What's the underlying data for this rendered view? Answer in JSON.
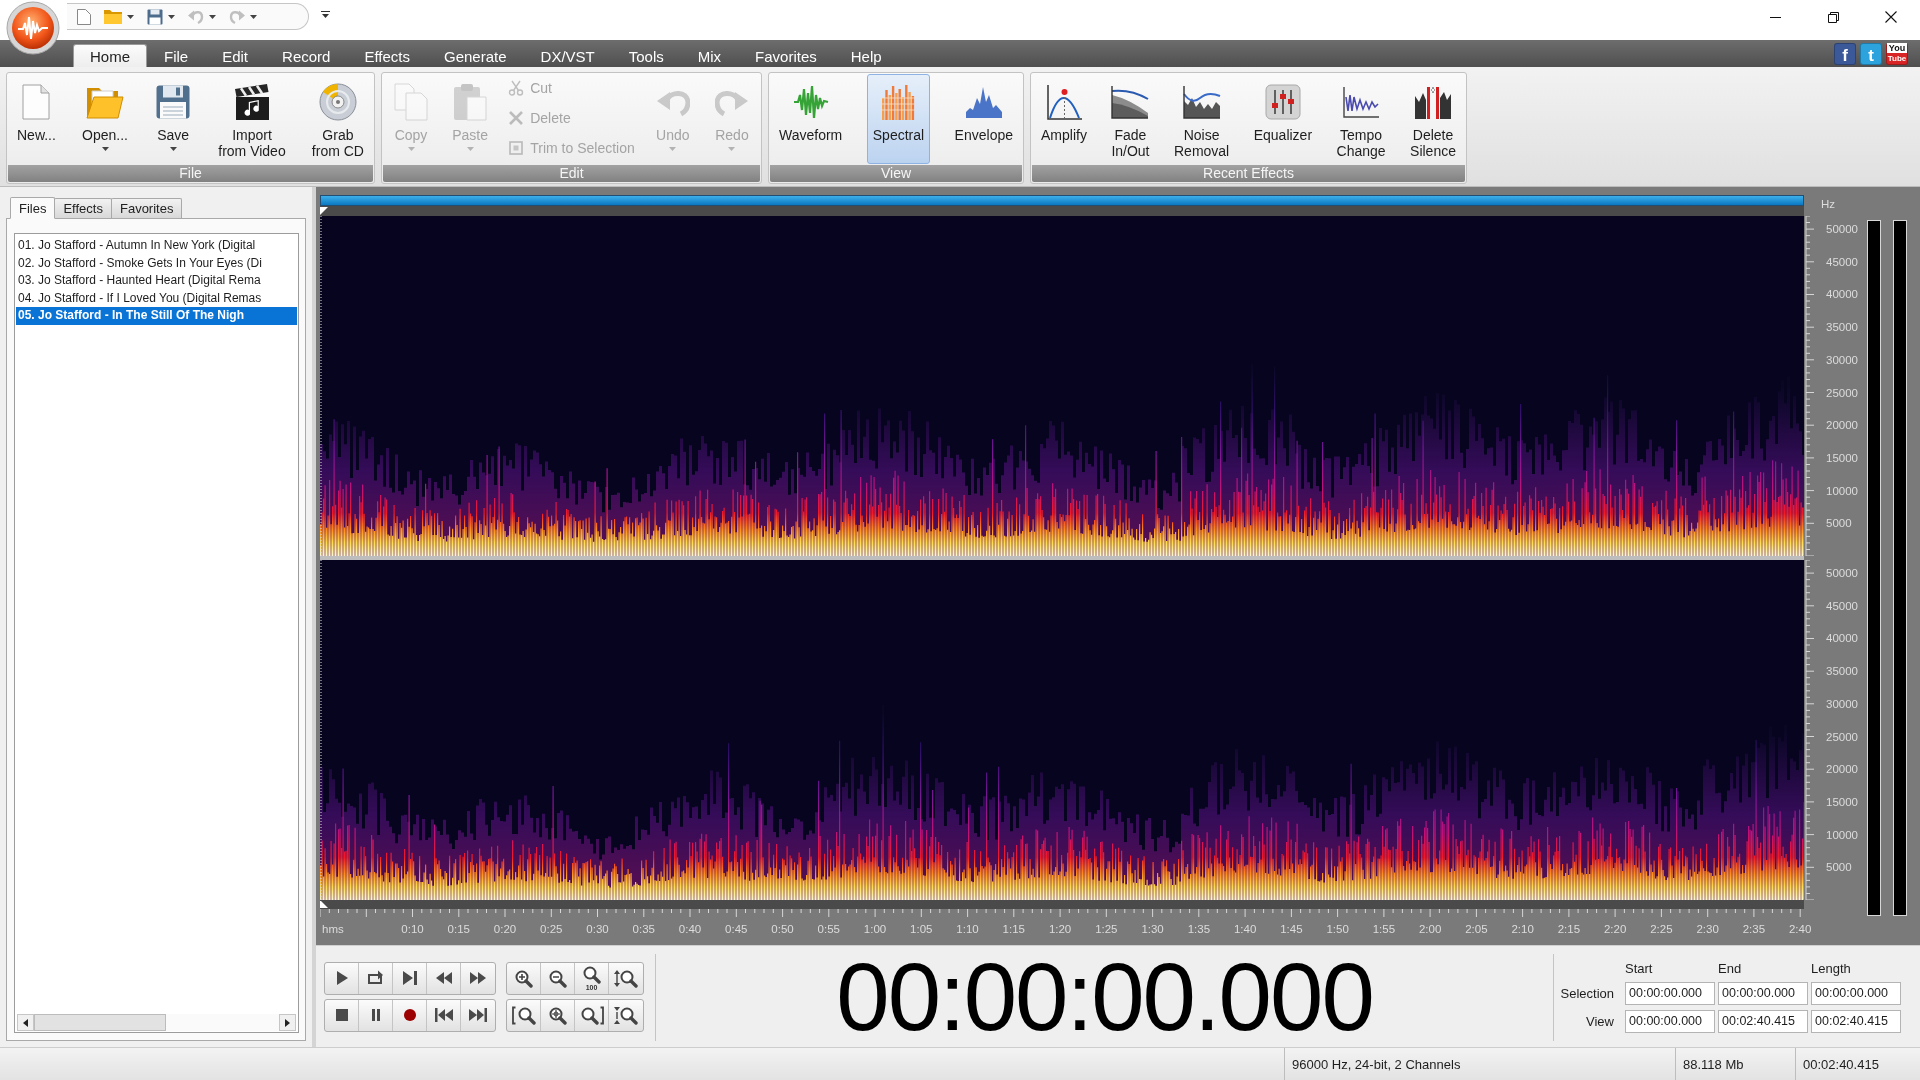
{
  "quick_access_toolbar": [
    {
      "disabled": false,
      "has_dropdown": false
    },
    {
      "disabled": false,
      "has_dropdown": true
    },
    {
      "disabled": false,
      "has_dropdown": true
    },
    {
      "disabled": true,
      "has_dropdown": true
    },
    {
      "disabled": true,
      "has_dropdown": true
    }
  ],
  "menu_tabs": [
    {
      "label": "Home",
      "selected": true
    },
    {
      "label": "File",
      "selected": false
    },
    {
      "label": "Edit",
      "selected": false
    },
    {
      "label": "Record",
      "selected": false
    },
    {
      "label": "Effects",
      "selected": false
    },
    {
      "label": "Generate",
      "selected": false
    },
    {
      "label": "DX/VST",
      "selected": false
    },
    {
      "label": "Tools",
      "selected": false
    },
    {
      "label": "Mix",
      "selected": false
    },
    {
      "label": "Favorites",
      "selected": false
    },
    {
      "label": "Help",
      "selected": false
    }
  ],
  "social_buttons": [
    {
      "kind": "letter",
      "text": "f",
      "color": "#3b5998"
    },
    {
      "kind": "letter",
      "text": "t",
      "color": "#2da3dd"
    },
    {
      "kind": "stacked",
      "text": "You",
      "text_2": "Tube",
      "color": "#d82424"
    }
  ],
  "ribbon": {
    "groups": [
      {
        "label": "File",
        "items": [
          {
            "kind": "large",
            "label": "New...",
            "disabled": false,
            "has_dropdown": false
          },
          {
            "kind": "large",
            "label": "Open...",
            "disabled": false,
            "has_dropdown": true
          },
          {
            "kind": "large",
            "label": "Save",
            "disabled": false,
            "has_dropdown": true
          },
          {
            "kind": "large",
            "label": "Import\nfrom Video",
            "disabled": false,
            "has_dropdown": false
          },
          {
            "kind": "large",
            "label": "Grab\nfrom CD",
            "disabled": false,
            "has_dropdown": false
          }
        ]
      },
      {
        "label": "Edit",
        "items": [
          {
            "kind": "large",
            "label": "Copy",
            "disabled": true,
            "has_dropdown": true
          },
          {
            "kind": "large",
            "label": "Paste",
            "disabled": true,
            "has_dropdown": true
          },
          {
            "kind": "small",
            "label": "Cut",
            "disabled": true,
            "has_dropdown": false
          },
          {
            "kind": "small",
            "label": "Delete",
            "disabled": true,
            "has_dropdown": false
          },
          {
            "kind": "small",
            "label": "Trim to Selection",
            "disabled": true,
            "has_dropdown": false
          },
          {
            "kind": "large",
            "label": "Undo",
            "disabled": true,
            "has_dropdown": true
          },
          {
            "kind": "large",
            "label": "Redo",
            "disabled": true,
            "has_dropdown": true
          }
        ]
      },
      {
        "label": "View",
        "items": [
          {
            "kind": "large",
            "label": "Waveform",
            "disabled": false,
            "has_dropdown": false,
            "selected": false
          },
          {
            "kind": "large",
            "label": "Spectral",
            "disabled": false,
            "has_dropdown": false,
            "selected": true
          },
          {
            "kind": "large",
            "label": "Envelope",
            "disabled": false,
            "has_dropdown": false,
            "selected": false
          }
        ]
      },
      {
        "label": "Recent Effects",
        "items": [
          {
            "kind": "large",
            "label": "Amplify",
            "disabled": false,
            "has_dropdown": false
          },
          {
            "kind": "large",
            "label": "Fade\nIn/Out",
            "disabled": false,
            "has_dropdown": false
          },
          {
            "kind": "large",
            "label": "Noise\nRemoval",
            "disabled": false,
            "has_dropdown": false
          },
          {
            "kind": "large",
            "label": "Equalizer",
            "disabled": false,
            "has_dropdown": false
          },
          {
            "kind": "large",
            "label": "Tempo\nChange",
            "disabled": false,
            "has_dropdown": false
          },
          {
            "kind": "large",
            "label": "Delete\nSilence",
            "disabled": false,
            "has_dropdown": false
          }
        ]
      }
    ]
  },
  "sidebar": {
    "tabs": [
      {
        "label": "Files",
        "selected": true
      },
      {
        "label": "Effects",
        "selected": false
      },
      {
        "label": "Favorites",
        "selected": false
      }
    ],
    "files": [
      {
        "name": "01. Jo Stafford - Autumn In New York (Digital",
        "selected": false
      },
      {
        "name": "02. Jo Stafford - Smoke Gets In Your Eyes (Di",
        "selected": false
      },
      {
        "name": "03. Jo Stafford - Haunted Heart (Digital Rema",
        "selected": false
      },
      {
        "name": "04. Jo Stafford - If I Loved You (Digital Remas",
        "selected": false
      },
      {
        "name": "05. Jo Stafford - In The Still Of The Nigh",
        "selected": true
      }
    ]
  },
  "editor": {
    "frequency_axis": {
      "unit": "Hz",
      "channels": [
        {
          "labels": [
            "50000",
            "45000",
            "40000",
            "35000",
            "30000",
            "25000",
            "20000",
            "15000",
            "10000",
            "5000"
          ]
        },
        {
          "labels": [
            "50000",
            "45000",
            "40000",
            "35000",
            "30000",
            "25000",
            "20000",
            "15000",
            "10000",
            "5000"
          ]
        }
      ]
    },
    "time_axis": {
      "unit": "hms",
      "labels": [
        "0:10",
        "0:15",
        "0:20",
        "0:25",
        "0:30",
        "0:35",
        "0:40",
        "0:45",
        "0:50",
        "0:55",
        "1:00",
        "1:05",
        "1:10",
        "1:15",
        "1:20",
        "1:25",
        "1:30",
        "1:35",
        "1:40",
        "1:45",
        "1:50",
        "1:55",
        "2:00",
        "2:05",
        "2:10",
        "2:15",
        "2:20",
        "2:25",
        "2:30",
        "2:35",
        "2:40"
      ]
    }
  },
  "zoom_toolbar": {
    "badge": "100"
  },
  "time_display": "00:00:00.000",
  "selection_panel": {
    "columns": [
      "Start",
      "End",
      "Length"
    ],
    "rows": [
      {
        "label": "Selection",
        "values": [
          "00:00:00.000",
          "00:00:00.000",
          "00:00:00.000"
        ]
      },
      {
        "label": "View",
        "values": [
          "00:00:00.000",
          "00:02:40.415",
          "00:02:40.415"
        ]
      }
    ]
  },
  "status_bar": [
    "96000 Hz, 24-bit, 2 Channels",
    "88.118 Mb",
    "00:02:40.415"
  ]
}
